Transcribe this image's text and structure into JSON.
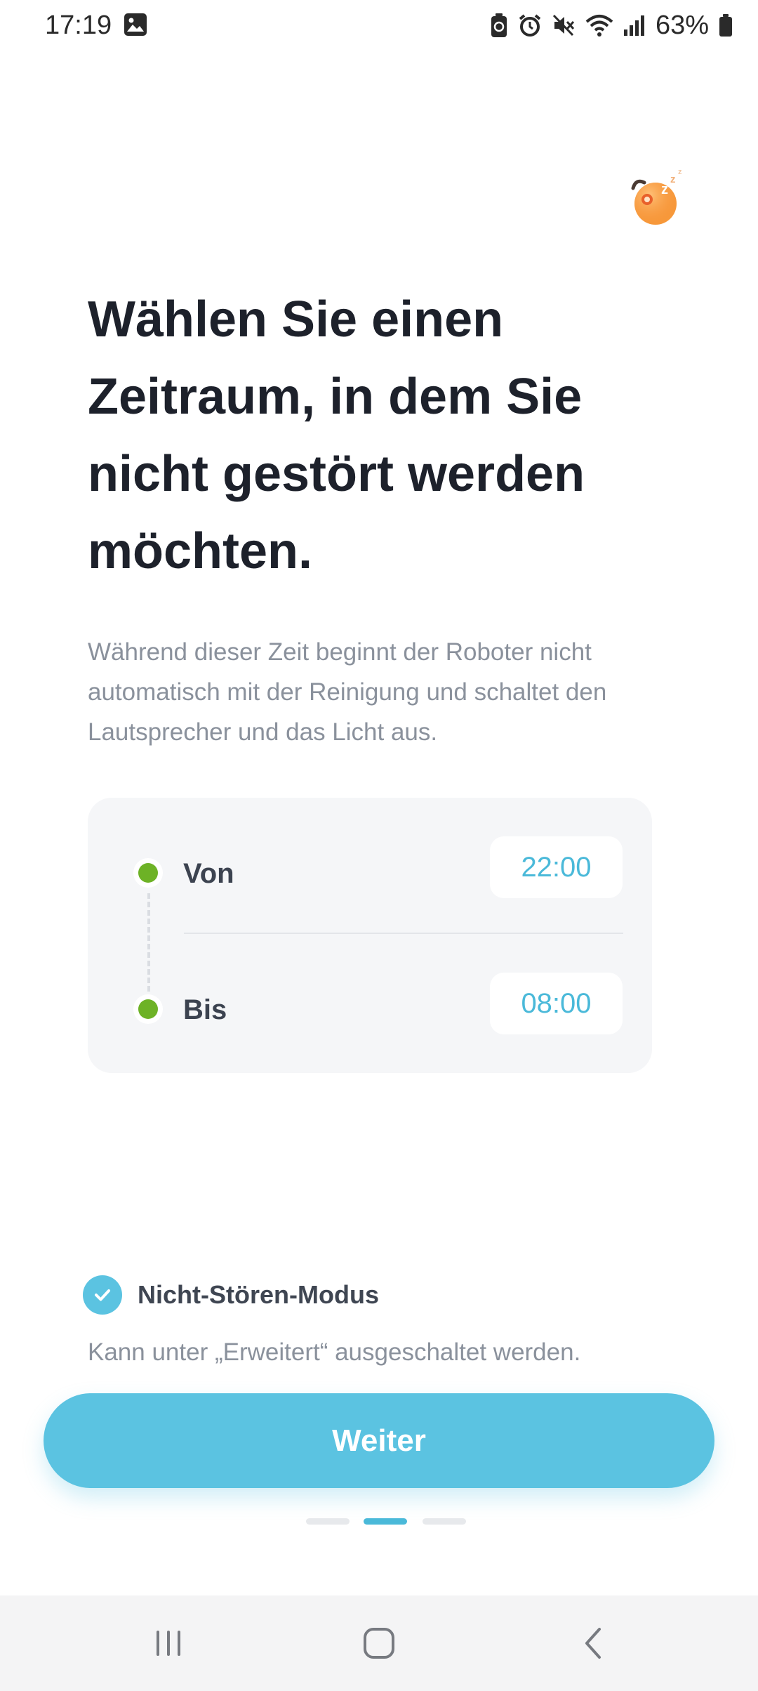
{
  "status_bar": {
    "time": "17:19",
    "battery_percent": "63%",
    "icons": [
      "image-icon",
      "battery-saver-icon",
      "alarm-icon",
      "mute-icon",
      "wifi-icon",
      "signal-icon",
      "battery-icon"
    ]
  },
  "mascot": {
    "icon": "sleeping-robot-icon"
  },
  "header": {
    "title": "Wählen Sie einen Zeitraum, in dem Sie nicht gestört werden möchten.",
    "description": "Während dieser Zeit beginnt der Roboter nicht automatisch mit der Reinigung und schaltet den Lautsprecher und das Licht aus."
  },
  "time_range": {
    "from_label": "Von",
    "from_value": "22:00",
    "to_label": "Bis",
    "to_value": "08:00"
  },
  "dnd": {
    "label": "Nicht-Stören-Modus",
    "checked": true,
    "hint": "Kann unter „Erweitert“ ausgeschaltet werden."
  },
  "actions": {
    "next_label": "Weiter"
  },
  "pagination": {
    "total": 3,
    "current": 2
  },
  "navigation": {
    "icons": [
      "recent-apps-icon",
      "home-icon",
      "back-icon"
    ]
  },
  "colors": {
    "accent": "#5bc3e1",
    "time_text": "#4ab9d9",
    "dot_green": "#6db226",
    "title": "#1d212b",
    "muted": "#8a919c"
  }
}
